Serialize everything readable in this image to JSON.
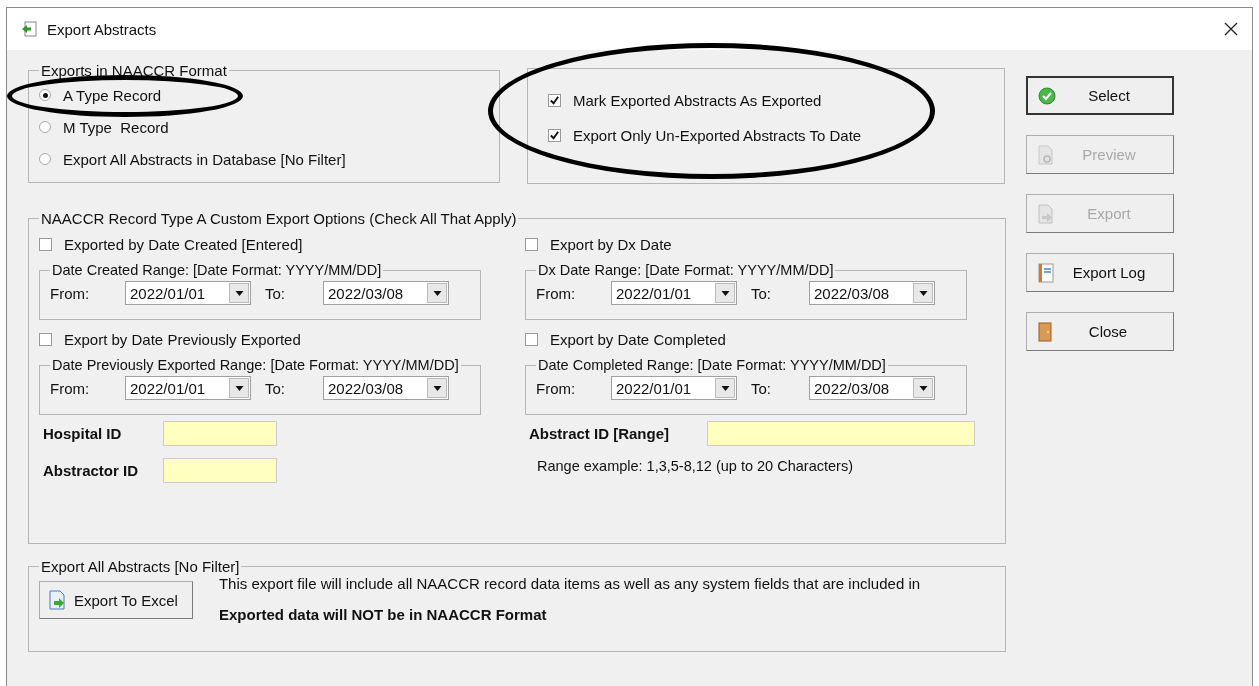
{
  "window": {
    "title": "Export Abstracts"
  },
  "naaccr_group": {
    "title": "Exports in NAACCR Format",
    "options": [
      {
        "label": "A Type Record",
        "selected": true,
        "circled": true
      },
      {
        "label": "M Type  Record",
        "selected": false,
        "circled": false
      },
      {
        "label": "Export All Abstracts in Database [No Filter]",
        "selected": false,
        "circled": false
      }
    ]
  },
  "mark_options": {
    "circled": true,
    "checkboxes": [
      {
        "label": "Mark Exported Abstracts As Exported",
        "checked": true
      },
      {
        "label": "Export Only Un-Exported Abstracts To Date",
        "checked": true
      }
    ]
  },
  "custom_options": {
    "title": "NAACCR Record Type A Custom Export Options (Check All That Apply)",
    "filters": [
      {
        "label": "Exported by Date Created [Entered]",
        "checked": false,
        "range_title": "Date Created Range: [Date Format: YYYY/MM/DD]",
        "from_label": "From:",
        "from": "2022/01/01",
        "to_label": "To:",
        "to": "2022/03/08"
      },
      {
        "label": "Export by Dx Date",
        "checked": false,
        "range_title": "Dx Date Range: [Date Format: YYYY/MM/DD]",
        "from_label": "From:",
        "from": "2022/01/01",
        "to_label": "To:",
        "to": "2022/03/08"
      },
      {
        "label": "Export by Date Previously Exported",
        "checked": false,
        "range_title": "Date Previously Exported Range: [Date Format: YYYY/MM/DD]",
        "from_label": "From:",
        "from": "2022/01/01",
        "to_label": "To:",
        "to": "2022/03/08"
      },
      {
        "label": "Export by Date Completed",
        "checked": false,
        "range_title": "Date Completed Range: [Date Format: YYYY/MM/DD]",
        "from_label": "From:",
        "from": "2022/01/01",
        "to_label": "To:",
        "to": "2022/03/08"
      }
    ],
    "id_fields": [
      {
        "label": "Hospital ID"
      },
      {
        "label": "Abstractor ID"
      }
    ],
    "abstract_id": {
      "label": "Abstract ID [Range]",
      "hint": "Range example: 1,3,5-8,12 (up to 20 Characters)"
    }
  },
  "buttons": [
    {
      "label": "Select",
      "kind": "select",
      "disabled": false,
      "default": true
    },
    {
      "label": "Preview",
      "kind": "preview",
      "disabled": true,
      "default": false
    },
    {
      "label": "Export",
      "kind": "export",
      "disabled": true,
      "default": false
    },
    {
      "label": "Export Log",
      "kind": "log",
      "disabled": false,
      "default": false
    },
    {
      "label": "Close",
      "kind": "close",
      "disabled": false,
      "default": false
    }
  ],
  "export_all": {
    "title": "Export All Abstracts [No Filter]",
    "button": "Export To Excel",
    "note": "This export file will include all NAACCR record data items as well as any system fields that  are included in",
    "warning": "Exported data will NOT be in NAACCR Format"
  }
}
